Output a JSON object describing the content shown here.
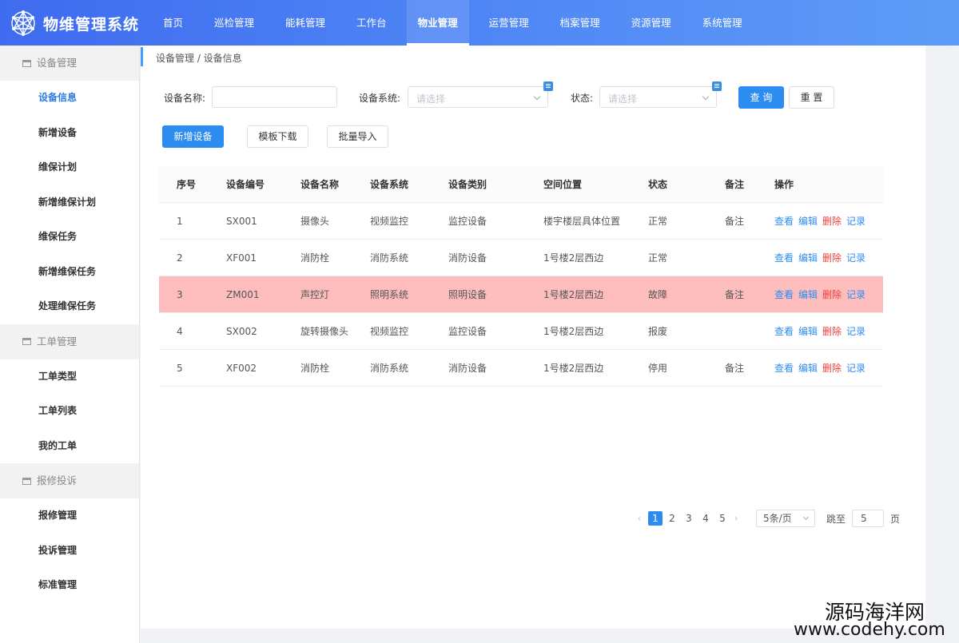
{
  "header": {
    "title": "物维管理系统",
    "nav": [
      {
        "label": "首页",
        "active": false
      },
      {
        "label": "巡检管理",
        "active": false
      },
      {
        "label": "能耗管理",
        "active": false
      },
      {
        "label": "工作台",
        "active": false
      },
      {
        "label": "物业管理",
        "active": true
      },
      {
        "label": "运营管理",
        "active": false
      },
      {
        "label": "档案管理",
        "active": false
      },
      {
        "label": "资源管理",
        "active": false
      },
      {
        "label": "系统管理",
        "active": false
      }
    ]
  },
  "sidebar": {
    "groups": [
      {
        "label": "设备管理",
        "items": [
          {
            "label": "设备信息",
            "active": true
          },
          {
            "label": "新增设备"
          },
          {
            "label": "维保计划"
          },
          {
            "label": "新增维保计划"
          },
          {
            "label": "维保任务"
          },
          {
            "label": "新增维保任务"
          },
          {
            "label": "处理维保任务"
          }
        ]
      },
      {
        "label": "工单管理",
        "items": [
          {
            "label": "工单类型"
          },
          {
            "label": "工单列表"
          },
          {
            "label": "我的工单"
          }
        ]
      },
      {
        "label": "报修投诉",
        "items": [
          {
            "label": "报修管理"
          },
          {
            "label": "投诉管理"
          },
          {
            "label": "标准管理"
          }
        ]
      }
    ]
  },
  "breadcrumb": "设备管理 / 设备信息",
  "filters": {
    "name_label": "设备名称:",
    "name_value": "",
    "system_label": "设备系统:",
    "system_placeholder": "请选择",
    "status_label": "状态:",
    "status_placeholder": "请选择",
    "query_button": "查 询",
    "reset_button": "重 置"
  },
  "actions": {
    "add": "新增设备",
    "template": "模板下载",
    "import": "批量导入"
  },
  "table": {
    "columns": [
      "序号",
      "设备编号",
      "设备名称",
      "设备系统",
      "设备类别",
      "空间位置",
      "状态",
      "备注",
      "操作"
    ],
    "rows": [
      {
        "cells": [
          "1",
          "SX001",
          "摄像头",
          "视频监控",
          "监控设备",
          "楼宇楼层具体位置",
          "正常",
          "备注"
        ],
        "fault": false
      },
      {
        "cells": [
          "2",
          "XF001",
          "消防栓",
          "消防系统",
          "消防设备",
          "1号楼2层西边",
          "正常",
          ""
        ],
        "fault": false
      },
      {
        "cells": [
          "3",
          "ZM001",
          "声控灯",
          "照明系统",
          "照明设备",
          "1号楼2层西边",
          "故障",
          "备注"
        ],
        "fault": true
      },
      {
        "cells": [
          "4",
          "SX002",
          "旋转摄像头",
          "视频监控",
          "监控设备",
          "1号楼2层西边",
          "报废",
          ""
        ],
        "fault": false
      },
      {
        "cells": [
          "5",
          "XF002",
          "消防栓",
          "消防系统",
          "消防设备",
          "1号楼2层西边",
          "停用",
          "备注"
        ],
        "fault": false
      }
    ],
    "ops": {
      "view": "查看",
      "edit": "编辑",
      "delete": "删除",
      "record": "记录"
    }
  },
  "pagination": {
    "pages": [
      "1",
      "2",
      "3",
      "4",
      "5"
    ],
    "current": "1",
    "page_size": "5条/页",
    "jump_label": "跳至",
    "jump_value": "5",
    "page_suffix": "页"
  },
  "watermark": {
    "line1": "源码海洋网",
    "line2": "www.codehy.com"
  },
  "colors": {
    "primary": "#2d8cf0",
    "danger": "#e8413b",
    "fault_row": "#fdbdbd",
    "header_start": "#3f6bf0",
    "header_end": "#5d9cf8"
  }
}
